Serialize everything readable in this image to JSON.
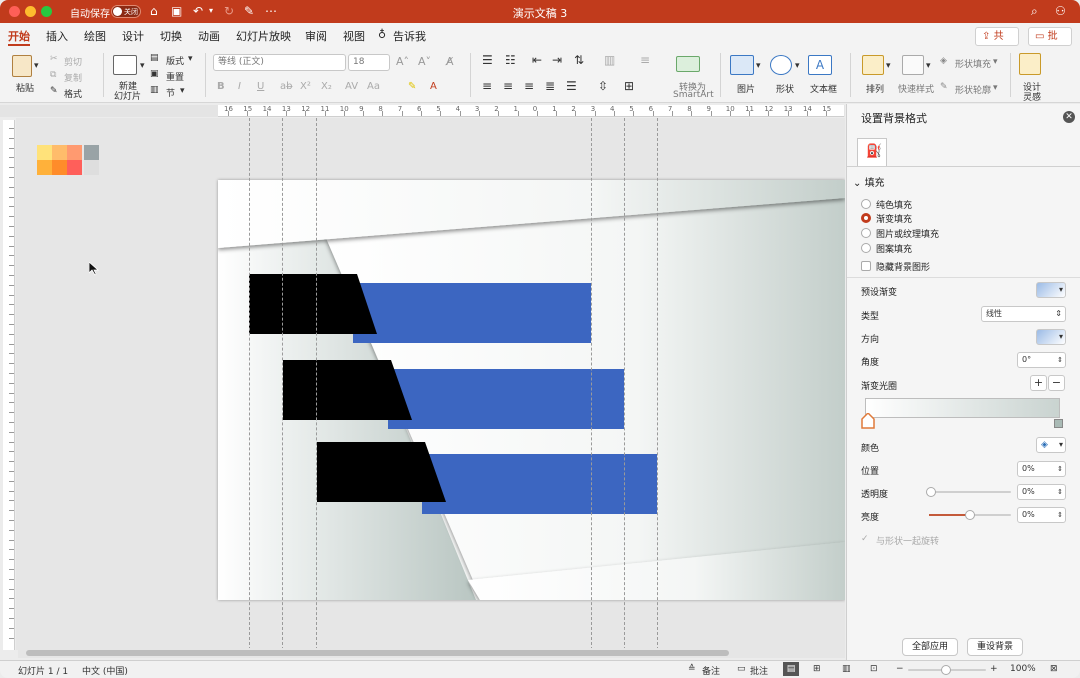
{
  "titlebar": {
    "autosave_label": "自动保存",
    "autosave_state": "关闭",
    "doc_title": "演示文稿 3"
  },
  "tabs": [
    "开始",
    "插入",
    "绘图",
    "设计",
    "切换",
    "动画",
    "幻灯片放映",
    "审阅",
    "视图"
  ],
  "tell_me": "告诉我",
  "share_label": "共享",
  "comment_label": "批注",
  "ribbon": {
    "paste": "粘贴",
    "cut": "剪切",
    "copy": "复制",
    "format": "格式",
    "new_slide_line1": "新建",
    "new_slide_line2": "幻灯片",
    "layout": "版式",
    "reset": "重置",
    "section": "节",
    "font_name": "等线 (正文)",
    "font_size": "18",
    "convert_line1": "转换为",
    "convert_line2": "SmartArt",
    "picture": "图片",
    "shape": "形状",
    "textbox": "文本框",
    "arrange": "排列",
    "quick_style": "快速样式",
    "shape_fill": "形状填充",
    "shape_outline": "形状轮廓",
    "designer_line1": "设计",
    "designer_line2": "灵感"
  },
  "ruler_labels": [
    "16",
    "15",
    "14",
    "13",
    "12",
    "11",
    "10",
    "9",
    "8",
    "7",
    "6",
    "5",
    "4",
    "3",
    "2",
    "1",
    "0",
    "1",
    "2",
    "3",
    "4",
    "5",
    "6",
    "7",
    "8",
    "9",
    "10",
    "11",
    "12",
    "13",
    "14",
    "15",
    "16"
  ],
  "pane": {
    "title": "设置背景格式",
    "section": "填充",
    "fill_options": [
      "纯色填充",
      "渐变填充",
      "图片或纹理填充",
      "图案填充"
    ],
    "selected_fill": 1,
    "hide_bg": "隐藏背景图形",
    "preset_label": "预设渐变",
    "type_label": "类型",
    "type_value": "线性",
    "direction_label": "方向",
    "angle_label": "角度",
    "angle_value": "0°",
    "stops_label": "渐变光圈",
    "color_label": "颜色",
    "position_label": "位置",
    "position_value": "0%",
    "transparency_label": "透明度",
    "transparency_value": "0%",
    "brightness_label": "亮度",
    "brightness_value": "0%",
    "rotate_label": "与形状一起旋转",
    "apply_all": "全部应用",
    "reset_bg": "重设背景"
  },
  "status": {
    "slide": "幻灯片 1 / 1",
    "language": "中文 (中国)",
    "notes": "备注",
    "comments": "批注",
    "zoom": "100%"
  },
  "colors": {
    "accent": "#c13b1c",
    "bar_blue": "#3c66c1",
    "gradient_end": "#c9d3d0"
  }
}
